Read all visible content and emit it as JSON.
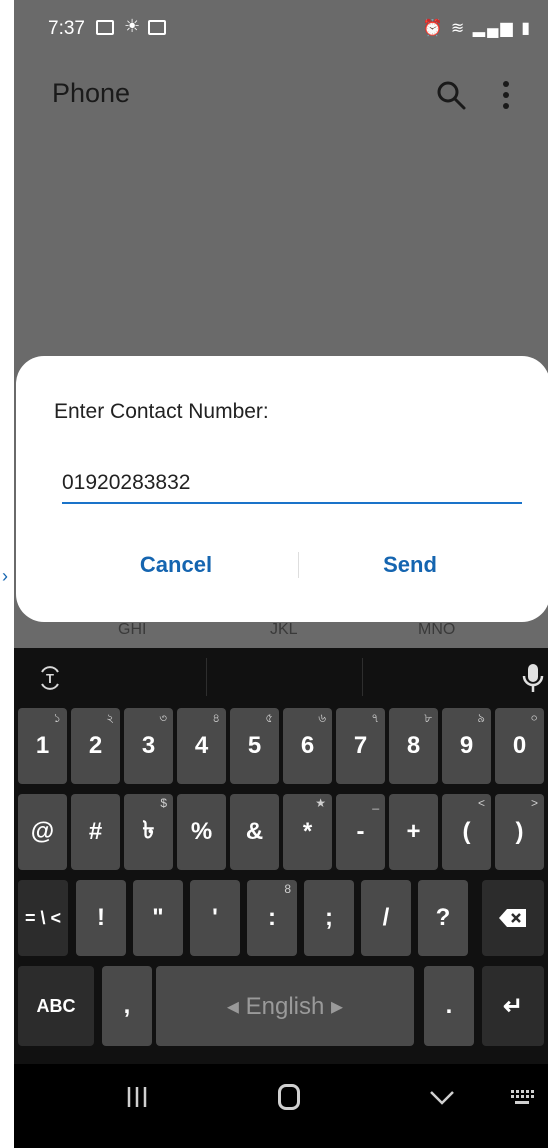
{
  "status_bar": {
    "time": "7:37"
  },
  "app": {
    "title": "Phone"
  },
  "background_keypad": {
    "labels": [
      "GHI",
      "JKL",
      "MNO"
    ]
  },
  "dialog": {
    "title": "Enter Contact Number:",
    "number_value": "01920283832",
    "cancel_label": "Cancel",
    "send_label": "Send"
  },
  "keyboard": {
    "row_numbers": [
      {
        "label": "1",
        "hint": "১"
      },
      {
        "label": "2",
        "hint": "২"
      },
      {
        "label": "3",
        "hint": "৩"
      },
      {
        "label": "4",
        "hint": "৪"
      },
      {
        "label": "5",
        "hint": "৫"
      },
      {
        "label": "6",
        "hint": "৬"
      },
      {
        "label": "7",
        "hint": "৭"
      },
      {
        "label": "8",
        "hint": "৮"
      },
      {
        "label": "9",
        "hint": "৯"
      },
      {
        "label": "0",
        "hint": "০"
      }
    ],
    "row_symbols": [
      {
        "label": "@",
        "hint": ""
      },
      {
        "label": "#",
        "hint": ""
      },
      {
        "label": "৳",
        "hint": "$"
      },
      {
        "label": "%",
        "hint": ""
      },
      {
        "label": "&",
        "hint": ""
      },
      {
        "label": "*",
        "hint": "★"
      },
      {
        "label": "-",
        "hint": "_"
      },
      {
        "label": "+",
        "hint": ""
      },
      {
        "label": "(",
        "hint": "<"
      },
      {
        "label": ")",
        "hint": ">"
      }
    ],
    "row_third": [
      {
        "label": "= \\ <",
        "hint": ""
      },
      {
        "label": "!",
        "hint": ""
      },
      {
        "label": "\"",
        "hint": ""
      },
      {
        "label": "'",
        "hint": ""
      },
      {
        "label": ":",
        "hint": "8"
      },
      {
        "label": ";",
        "hint": ""
      },
      {
        "label": "/",
        "hint": ""
      },
      {
        "label": "?",
        "hint": ""
      }
    ],
    "abc_label": "ABC",
    "comma_label": ",",
    "space_label": "◂ English ▸",
    "period_label": ".",
    "enter_label": "↵"
  },
  "colors": {
    "accent": "#1565b0",
    "underline": "#1a73c9",
    "dim_background": "#6a6a6a",
    "keyboard": "#111111"
  }
}
